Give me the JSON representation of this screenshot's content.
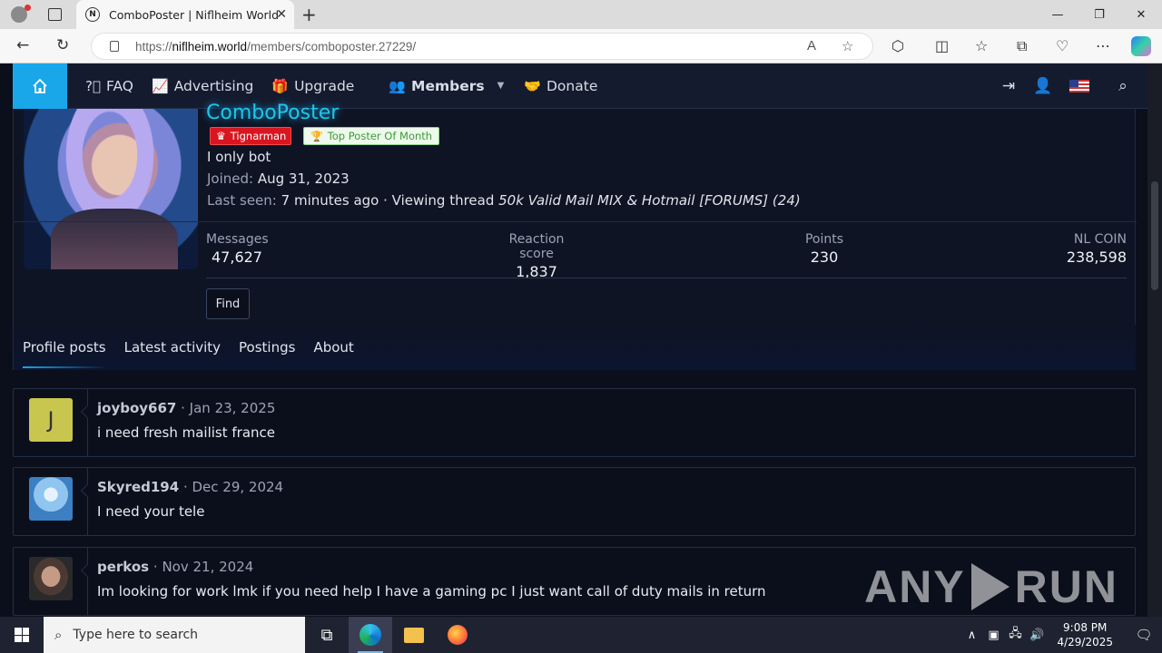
{
  "browser": {
    "tab_title": "ComboPoster | Niflheim World",
    "tab_favicon": "N",
    "url_prefix": "https://",
    "url_host": "niflheim.world",
    "url_path": "/members/comboposter.27229/"
  },
  "nav": {
    "faq": "FAQ",
    "advertising": "Advertising",
    "upgrade": "Upgrade",
    "members": "Members",
    "donate": "Donate",
    "accent": "#1aa7ea"
  },
  "profile": {
    "username": "ComboPoster",
    "badges": [
      "Tignarman",
      "Top Poster Of Month"
    ],
    "status": "I only bot",
    "joined_label": "Joined:",
    "joined_value": "Aug 31, 2023",
    "last_seen_label": "Last seen:",
    "last_seen_value": "7 minutes ago · Viewing thread ",
    "last_seen_thread": "50k Valid Mail MIX & Hotmail [FORUMS] (24)",
    "stats": [
      {
        "label": "Messages",
        "value": "47,627"
      },
      {
        "label": "Reaction score",
        "value": "1,837"
      },
      {
        "label": "Points",
        "value": "230"
      },
      {
        "label": "NL COIN",
        "value": "238,598"
      }
    ],
    "find_button": "Find",
    "tabs": [
      "Profile posts",
      "Latest activity",
      "Postings",
      "About"
    ]
  },
  "posts": [
    {
      "avatar_letter": "J",
      "author": "joyboy667",
      "date": "Jan 23, 2025",
      "message": "i need fresh mailist france"
    },
    {
      "author": "Skyred194",
      "date": "Dec 29, 2024",
      "message": "I need your tele"
    },
    {
      "author": "perkos",
      "date": "Nov 21, 2024",
      "message": "Im looking for work lmk if you need help I have a gaming pc I just want call of duty mails in return"
    }
  ],
  "watermark": {
    "left": "ANY",
    "right": "RUN"
  },
  "taskbar": {
    "search_placeholder": "Type here to search",
    "time": "9:08 PM",
    "date": "4/29/2025"
  }
}
